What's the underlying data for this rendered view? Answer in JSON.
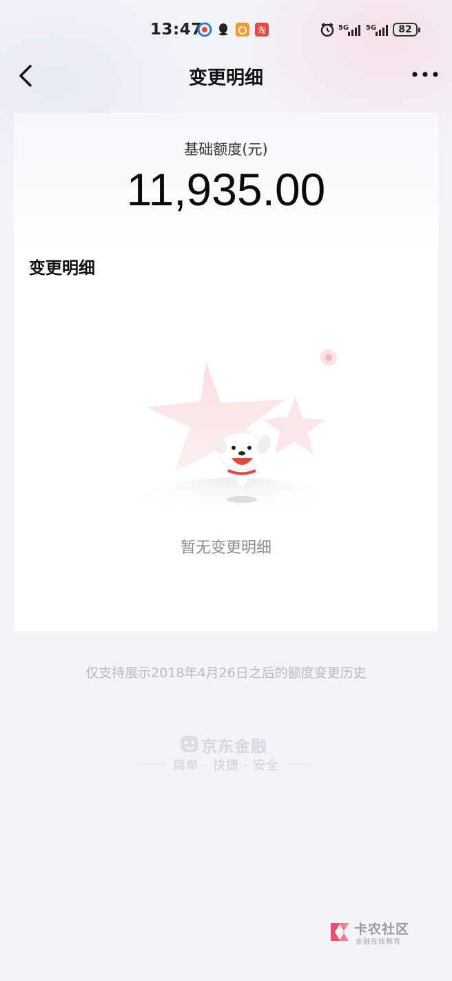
{
  "status_bar": {
    "time": "13:47",
    "battery": "82",
    "network_1": "5G",
    "network_2": "5G",
    "app_icons": [
      "tv-app-icon",
      "qq-icon",
      "app-icon",
      "taobao-icon"
    ]
  },
  "nav": {
    "title": "变更明细",
    "back_icon": "chevron-left-icon",
    "more_icon": "more-horizontal-icon"
  },
  "card": {
    "quota_label": "基础额度(元)",
    "quota_value": "11,935.00",
    "section_title": "变更明细",
    "empty_text": "暂无变更明细"
  },
  "footnote": "仅支持展示2018年4月26日之后的额度变更历史",
  "brand": {
    "name": "京东金融",
    "slogan": "简单 · 快捷 · 安全"
  },
  "watermark": {
    "name": "卡农社区",
    "subtitle": "金融在线教育"
  },
  "colors": {
    "background": "#f3f3f8",
    "card": "#ffffff",
    "accent_red": "#e8453c",
    "muted_text": "#8a8a8a"
  }
}
